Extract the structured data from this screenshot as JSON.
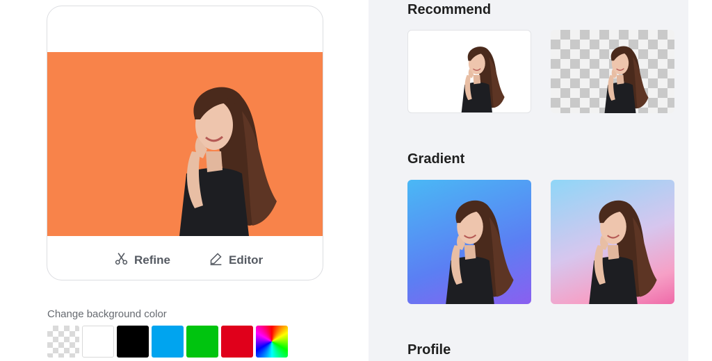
{
  "preview": {
    "background_color": "#f8834a",
    "actions": {
      "refine_label": "Refine",
      "editor_label": "Editor"
    }
  },
  "background_picker": {
    "label": "Change background color",
    "swatches": [
      {
        "name": "transparent",
        "color": "transparent"
      },
      {
        "name": "white",
        "color": "#ffffff"
      },
      {
        "name": "black",
        "color": "#000000"
      },
      {
        "name": "blue",
        "color": "#00a4ef"
      },
      {
        "name": "green",
        "color": "#00c40f"
      },
      {
        "name": "red",
        "color": "#e0001b"
      },
      {
        "name": "rainbow",
        "color": "conic-gradient"
      }
    ]
  },
  "sections": {
    "recommend": {
      "title": "Recommend",
      "thumbnails": [
        "white background",
        "transparent background"
      ]
    },
    "gradient": {
      "title": "Gradient",
      "thumbnails": [
        "blue-purple gradient",
        "pastel pink gradient"
      ]
    },
    "profile": {
      "title": "Profile"
    }
  },
  "icons": {
    "refine": "scissors-icon",
    "editor": "pencil-icon"
  }
}
